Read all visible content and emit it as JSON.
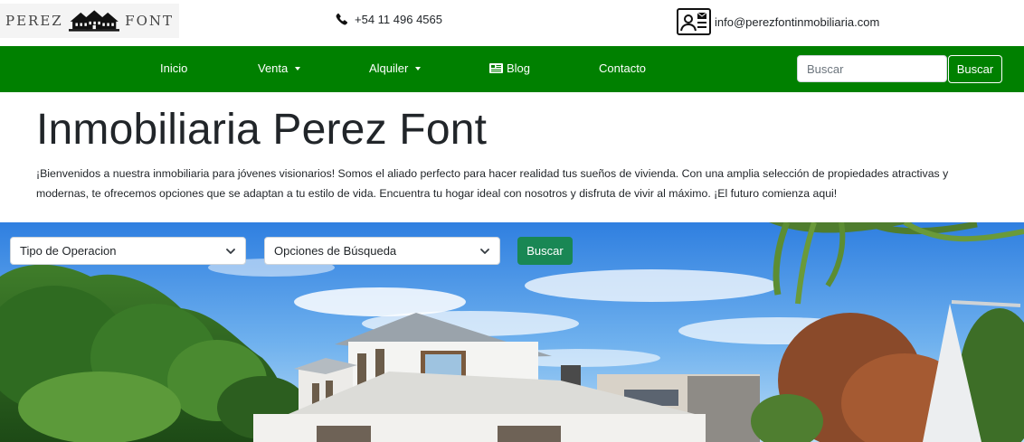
{
  "header": {
    "logo": {
      "word_left": "PEREZ",
      "word_right": "FONT",
      "icon": "houses-icon"
    },
    "phone": {
      "icon": "phone-icon",
      "text": "+54 11 496 4565"
    },
    "email": {
      "icon": "contact-card-mail-icon",
      "text": "info@perezfontinmobiliaria.com"
    }
  },
  "navbar": {
    "background": "#008000",
    "items": [
      {
        "label": "Inicio",
        "dropdown": false
      },
      {
        "label": "Venta",
        "dropdown": true
      },
      {
        "label": "Alquiler",
        "dropdown": true
      },
      {
        "label": "Blog",
        "icon": "newspaper-icon"
      },
      {
        "label": "Contacto",
        "dropdown": false
      }
    ],
    "search": {
      "placeholder": "Buscar",
      "value": "",
      "button_label": "Buscar"
    }
  },
  "main": {
    "title": "Inmobiliaria Perez Font",
    "intro": "¡Bienvenidos a nuestra inmobiliaria para jóvenes visionarios! Somos el aliado perfecto para hacer realidad tus sueños de vivienda. Con una amplia selección de propiedades atractivas y modernas, te ofrecemos opciones que se adaptan a tu estilo de vida. Encuentra tu hogar ideal con nosotros y disfruta de vivir al máximo. ¡El futuro comienza aqui!"
  },
  "hero": {
    "filters": {
      "operation_select": "Tipo de Operacion",
      "search_options_select": "Opciones de Búsqueda",
      "button_label": "Buscar",
      "button_color": "#198754"
    }
  }
}
